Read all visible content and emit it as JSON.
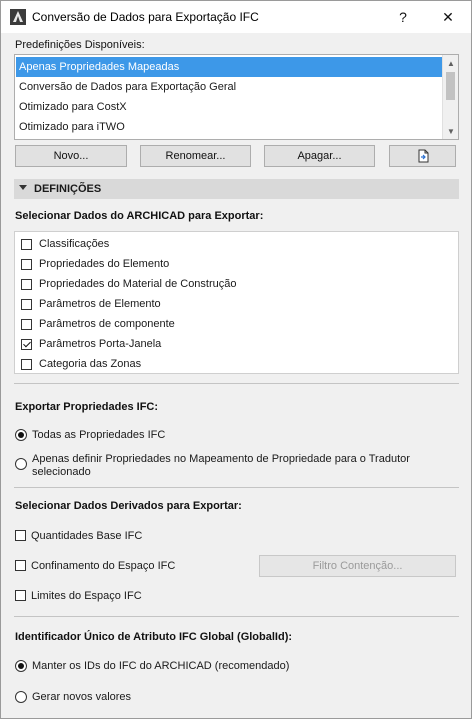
{
  "window": {
    "title": "Conversão de Dados para Exportação IFC",
    "help": "?",
    "close": "✕"
  },
  "presets": {
    "label": "Predefinições Disponíveis:",
    "items": [
      "Apenas Propriedades Mapeadas",
      "Conversão de Dados para Exportação Geral",
      "Otimizado para CostX",
      "Otimizado para iTWO"
    ],
    "selected_index": 0
  },
  "buttons": {
    "new": "Novo...",
    "rename": "Renomear...",
    "delete": "Apagar...",
    "import_icon": "import-file-icon"
  },
  "definitions": {
    "title": "DEFINIÇÕES",
    "archicad_label": "Selecionar Dados do ARCHICAD para Exportar:",
    "archicad_items": [
      {
        "label": "Classificações",
        "checked": false
      },
      {
        "label": "Propriedades do Elemento",
        "checked": false
      },
      {
        "label": "Propriedades do Material de Construção",
        "checked": false
      },
      {
        "label": "Parâmetros de Elemento",
        "checked": false
      },
      {
        "label": "Parâmetros de componente",
        "checked": false
      },
      {
        "label": "Parâmetros Porta-Janela",
        "checked": true
      },
      {
        "label": "Categoria das Zonas",
        "checked": false
      }
    ]
  },
  "ifc_props": {
    "label": "Exportar Propriedades IFC:",
    "all": "Todas as Propriedades IFC",
    "mapped": "Apenas definir Propriedades no Mapeamento de Propriedade para o Tradutor selecionado",
    "selected": "all"
  },
  "derived": {
    "label": "Selecionar Dados Derivados para Exportar:",
    "base_quantities": "Quantidades Base IFC",
    "space_containment": "Confinamento do Espaço IFC",
    "containment_filter": "Filtro Contenção...",
    "space_boundaries": "Limites do Espaço IFC"
  },
  "guid": {
    "label": "Identificador Único de Atributo IFC Global (GlobalId):",
    "keep": "Manter os IDs do IFC do ARCHICAD (recomendado)",
    "generate": "Gerar novos valores",
    "selected": "keep"
  }
}
